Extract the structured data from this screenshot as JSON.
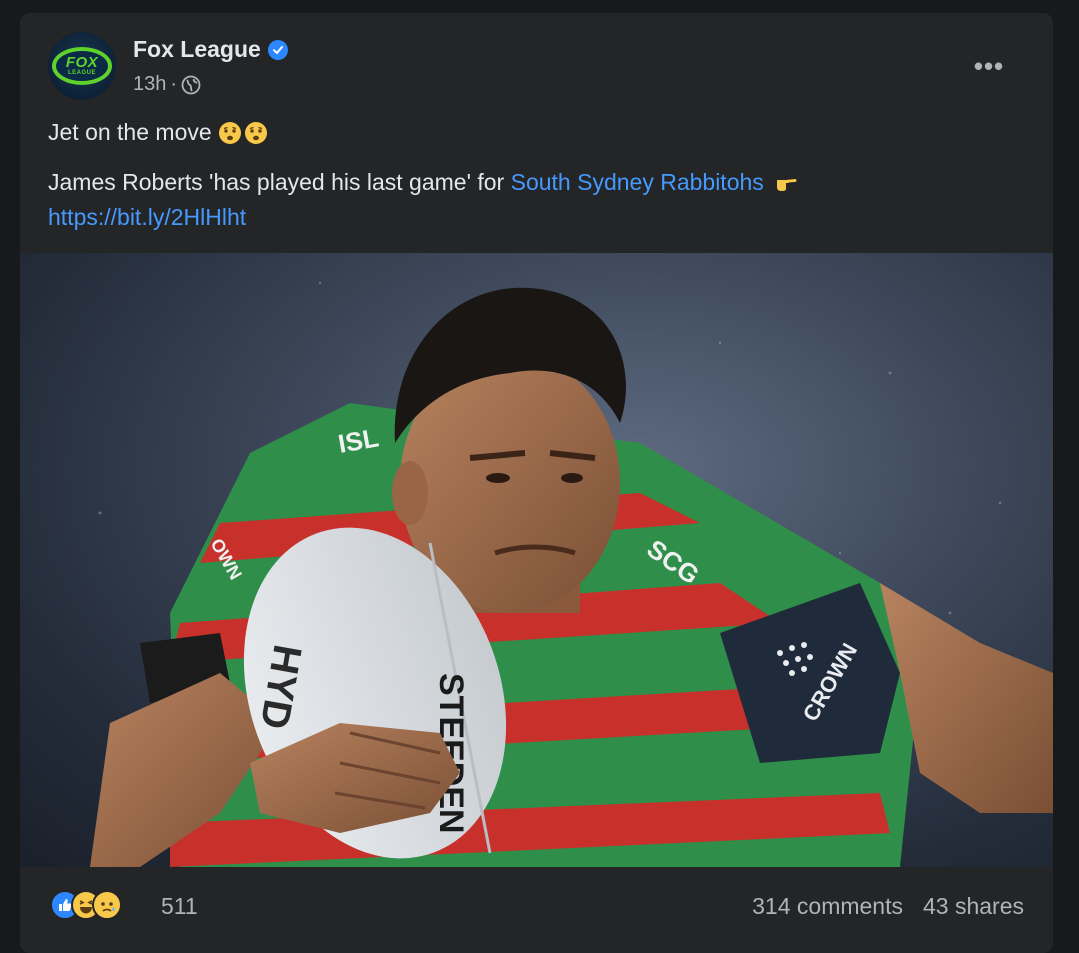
{
  "post": {
    "page_name": "Fox League",
    "avatar_text_top": "FOX",
    "avatar_text_bottom": "LEAGUE",
    "time": "13h",
    "separator": "·",
    "privacy_icon": "globe-icon",
    "more_icon": "more-options-icon",
    "text_line1": "Jet on the move",
    "text_line1_emojis": [
      "worried-face",
      "worried-face"
    ],
    "text_line2_prefix": "James Roberts 'has played his last game' for ",
    "text_line2_link": "South Sydney Rabbitohs",
    "text_line2_emoji": "pointing-right-hand",
    "url": "https://bit.ly/2HlHlht"
  },
  "photo": {
    "jersey_text": [
      "ISL",
      "OWN SPORTS",
      "SCG",
      "CROWN RESORTS",
      "STEEDEN",
      "HYD"
    ]
  },
  "footer": {
    "reaction_icons": [
      "like-reaction",
      "haha-reaction",
      "sad-reaction"
    ],
    "reaction_count": "511",
    "comments": "314 comments",
    "shares": "43 shares"
  },
  "colors": {
    "background": "#18191a",
    "card": "#242526",
    "link": "#4599ff",
    "secondary_text": "#b0b3b8",
    "verified": "#2d88ff",
    "fox_green": "#5fd32b"
  }
}
